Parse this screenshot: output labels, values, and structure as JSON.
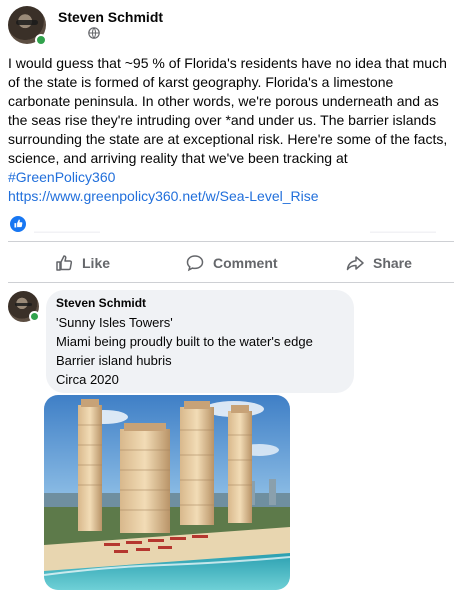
{
  "post": {
    "author": "Steven Schmidt",
    "text_parts": [
      "I would guess that ~95 % of Florida's residents have no idea that much of the state is formed of karst geography. Florida's a limestone carbonate peninsula. In other words, we're porous underneath and as the seas rise they're intruding over *and under us. The barrier islands surrounding the state are at exceptional risk. Here're some of the facts, science, and arriving reality that we've been tracking at "
    ],
    "hashtag": "#GreenPolicy360",
    "link": "https://www.greenpolicy360.net/w/Sea-Level_Rise",
    "privacy_icon": "globe-icon",
    "reaction_icon": "like-reaction-icon",
    "faint_left": "——————",
    "faint_right": "——————"
  },
  "actions": {
    "like": "Like",
    "comment": "Comment",
    "share": "Share"
  },
  "comment": {
    "author": "Steven Schmidt",
    "lines": [
      "'Sunny Isles Towers'",
      "Miami being proudly built to the water's edge",
      "Barrier island hubris",
      "Circa 2020"
    ],
    "photo_icon": "photo-sunny-isles-towers"
  },
  "colors": {
    "link": "#216fdb",
    "online": "#31a24c",
    "bubble": "#f0f2f5",
    "muted": "#65676b"
  }
}
